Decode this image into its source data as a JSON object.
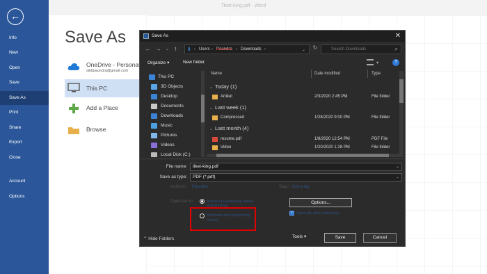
{
  "word": {
    "window_title": "Tiket-king.pdf - Word",
    "page_title": "Save As",
    "nav": [
      "Info",
      "New",
      "Open",
      "Save",
      "Save As",
      "Print",
      "Share",
      "Export",
      "Close",
      "Account",
      "Options"
    ],
    "active_nav": "Save As",
    "locations": [
      {
        "name": "OneDrive - Personal",
        "sub": "siktipaundra@gmail.com",
        "icon": "cloud-icon"
      },
      {
        "name": "This PC",
        "sub": "",
        "icon": "computer-icon"
      },
      {
        "name": "Add a Place",
        "sub": "",
        "icon": "plus-icon"
      },
      {
        "name": "Browse",
        "sub": "",
        "icon": "folder-icon"
      }
    ],
    "accent": "#2b579a"
  },
  "dialog": {
    "title": "Save As",
    "address": {
      "root": "Users",
      "user": "Paundra",
      "folder": "Downloads"
    },
    "search_placeholder": "Search Downloads",
    "organize_label": "Organize ▾",
    "new_folder_label": "New folder",
    "tree": [
      "This PC",
      "3D Objects",
      "Desktop",
      "Documents",
      "Downloads",
      "Music",
      "Pictures",
      "Videos",
      "Local Disk (C:)"
    ],
    "columns": {
      "name": "Name",
      "date": "Date modified",
      "type": "Type"
    },
    "groups": [
      {
        "label": "Today (1)",
        "files": [
          {
            "name": "Artikel",
            "date": "2/3/2020 2:45 PM",
            "type": "File folder",
            "kind": "folder"
          }
        ]
      },
      {
        "label": "Last week (1)",
        "files": [
          {
            "name": "Compressed",
            "date": "1/28/2020 9:00 PM",
            "type": "File folder",
            "kind": "folder"
          }
        ]
      },
      {
        "label": "Last month (4)",
        "files": [
          {
            "name": "resume.pdf",
            "date": "1/8/2020 12:54 PM",
            "type": "PDF File",
            "kind": "pdf"
          },
          {
            "name": "Video",
            "date": "1/20/2020 1:28 PM",
            "type": "File folder",
            "kind": "folder"
          }
        ]
      }
    ],
    "file_name_label": "File name:",
    "file_name_value": "tiket-king.pdf",
    "save_type_label": "Save as type:",
    "save_type_value": "PDF (*.pdf)",
    "authors_label": "Authors:",
    "authors_value": "Paundra",
    "tags_label": "Tags:",
    "tags_value": "Add a tag",
    "optimize_label": "Optimize for:",
    "optimize_standard": "Standard (publishing online and printing)",
    "optimize_minimum": "Minimum size (publishing online)",
    "options_label": "Options...",
    "open_after_label": "Open file after publishing",
    "tools_label": "Tools",
    "save_label": "Save",
    "cancel_label": "Cancel",
    "hide_folders_label": "Hide Folders"
  }
}
